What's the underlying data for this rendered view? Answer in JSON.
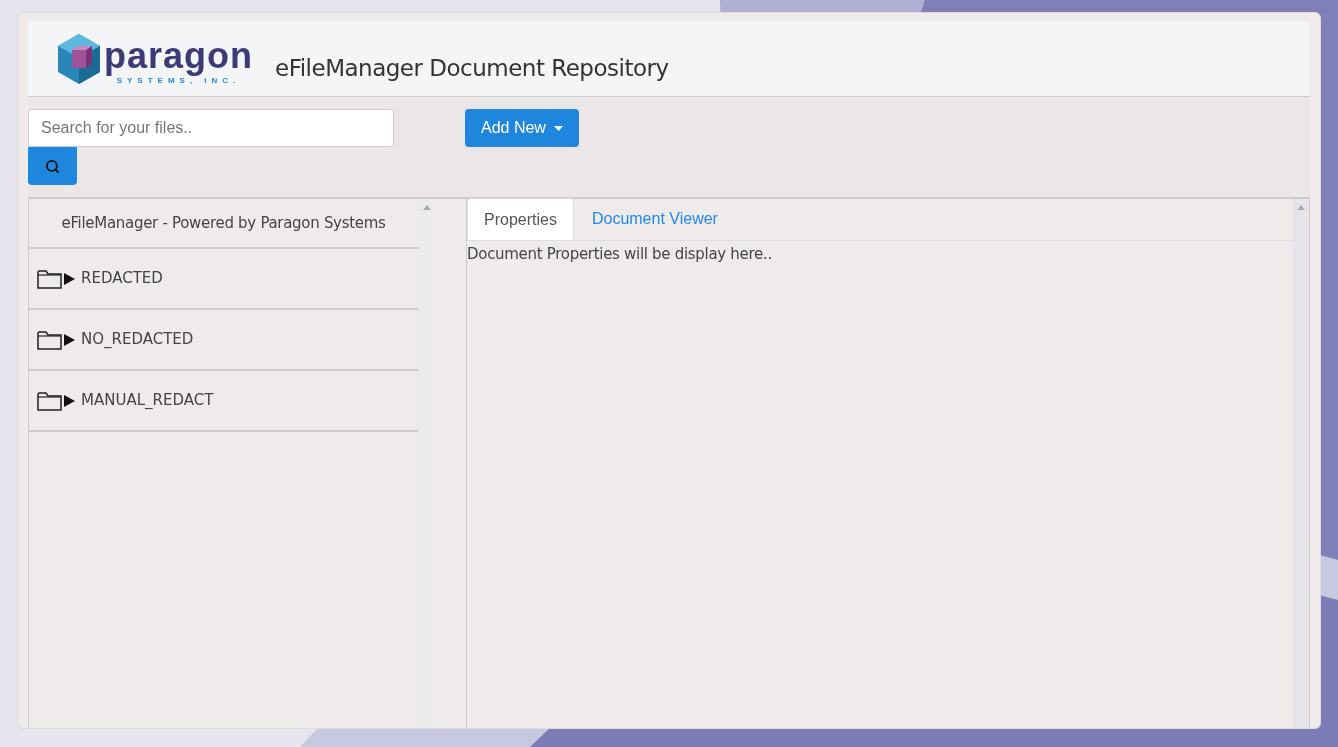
{
  "header": {
    "logo": {
      "wordmark": "paragon",
      "tagline": "SYSTEMS, INC."
    },
    "title": "eFileManager Document Repository"
  },
  "toolbar": {
    "search": {
      "placeholder": "Search for your files.."
    },
    "add_button": "Add New"
  },
  "sidebar": {
    "heading": "eFileManager - Powered by Paragon Systems",
    "items": [
      {
        "label": "REDACTED",
        "expanded": false
      },
      {
        "label": "NO_REDACTED",
        "expanded": false
      },
      {
        "label": "MANUAL_REDACT",
        "expanded": false
      }
    ]
  },
  "tabs": [
    {
      "label": "Properties",
      "selected": true
    },
    {
      "label": "Document Viewer",
      "selected": false
    }
  ],
  "content": "Document Properties will be display here.."
}
